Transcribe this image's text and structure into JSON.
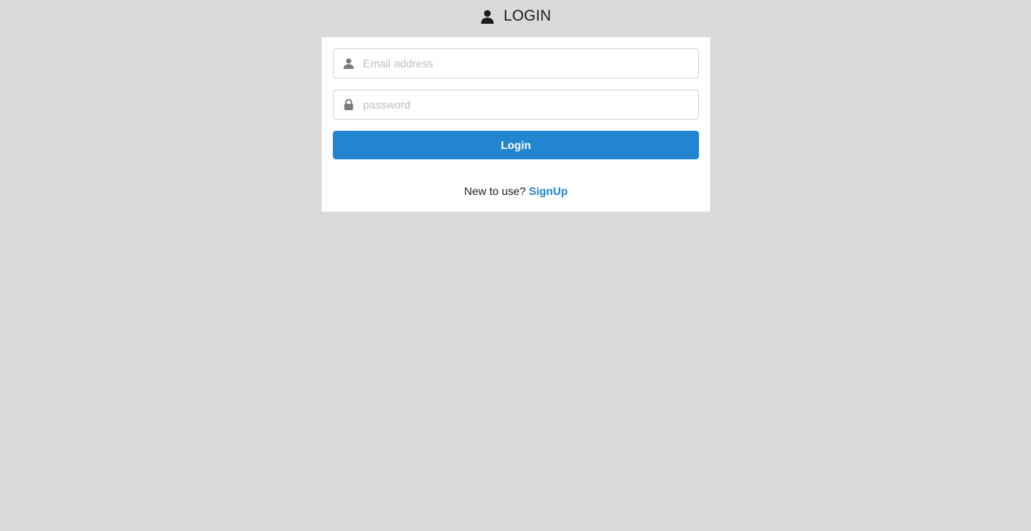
{
  "header": {
    "icon": "user-icon",
    "title": "LOGIN"
  },
  "form": {
    "email": {
      "icon": "user-icon",
      "placeholder": "Email address",
      "value": ""
    },
    "password": {
      "icon": "lock-icon",
      "placeholder": "password",
      "value": ""
    },
    "submit_label": "Login",
    "signup_prompt": "New to use?",
    "signup_link": "SignUp"
  },
  "colors": {
    "background": "#dadada",
    "accent": "#2185d0",
    "card": "#ffffff",
    "icon": "#7a7a7a"
  }
}
